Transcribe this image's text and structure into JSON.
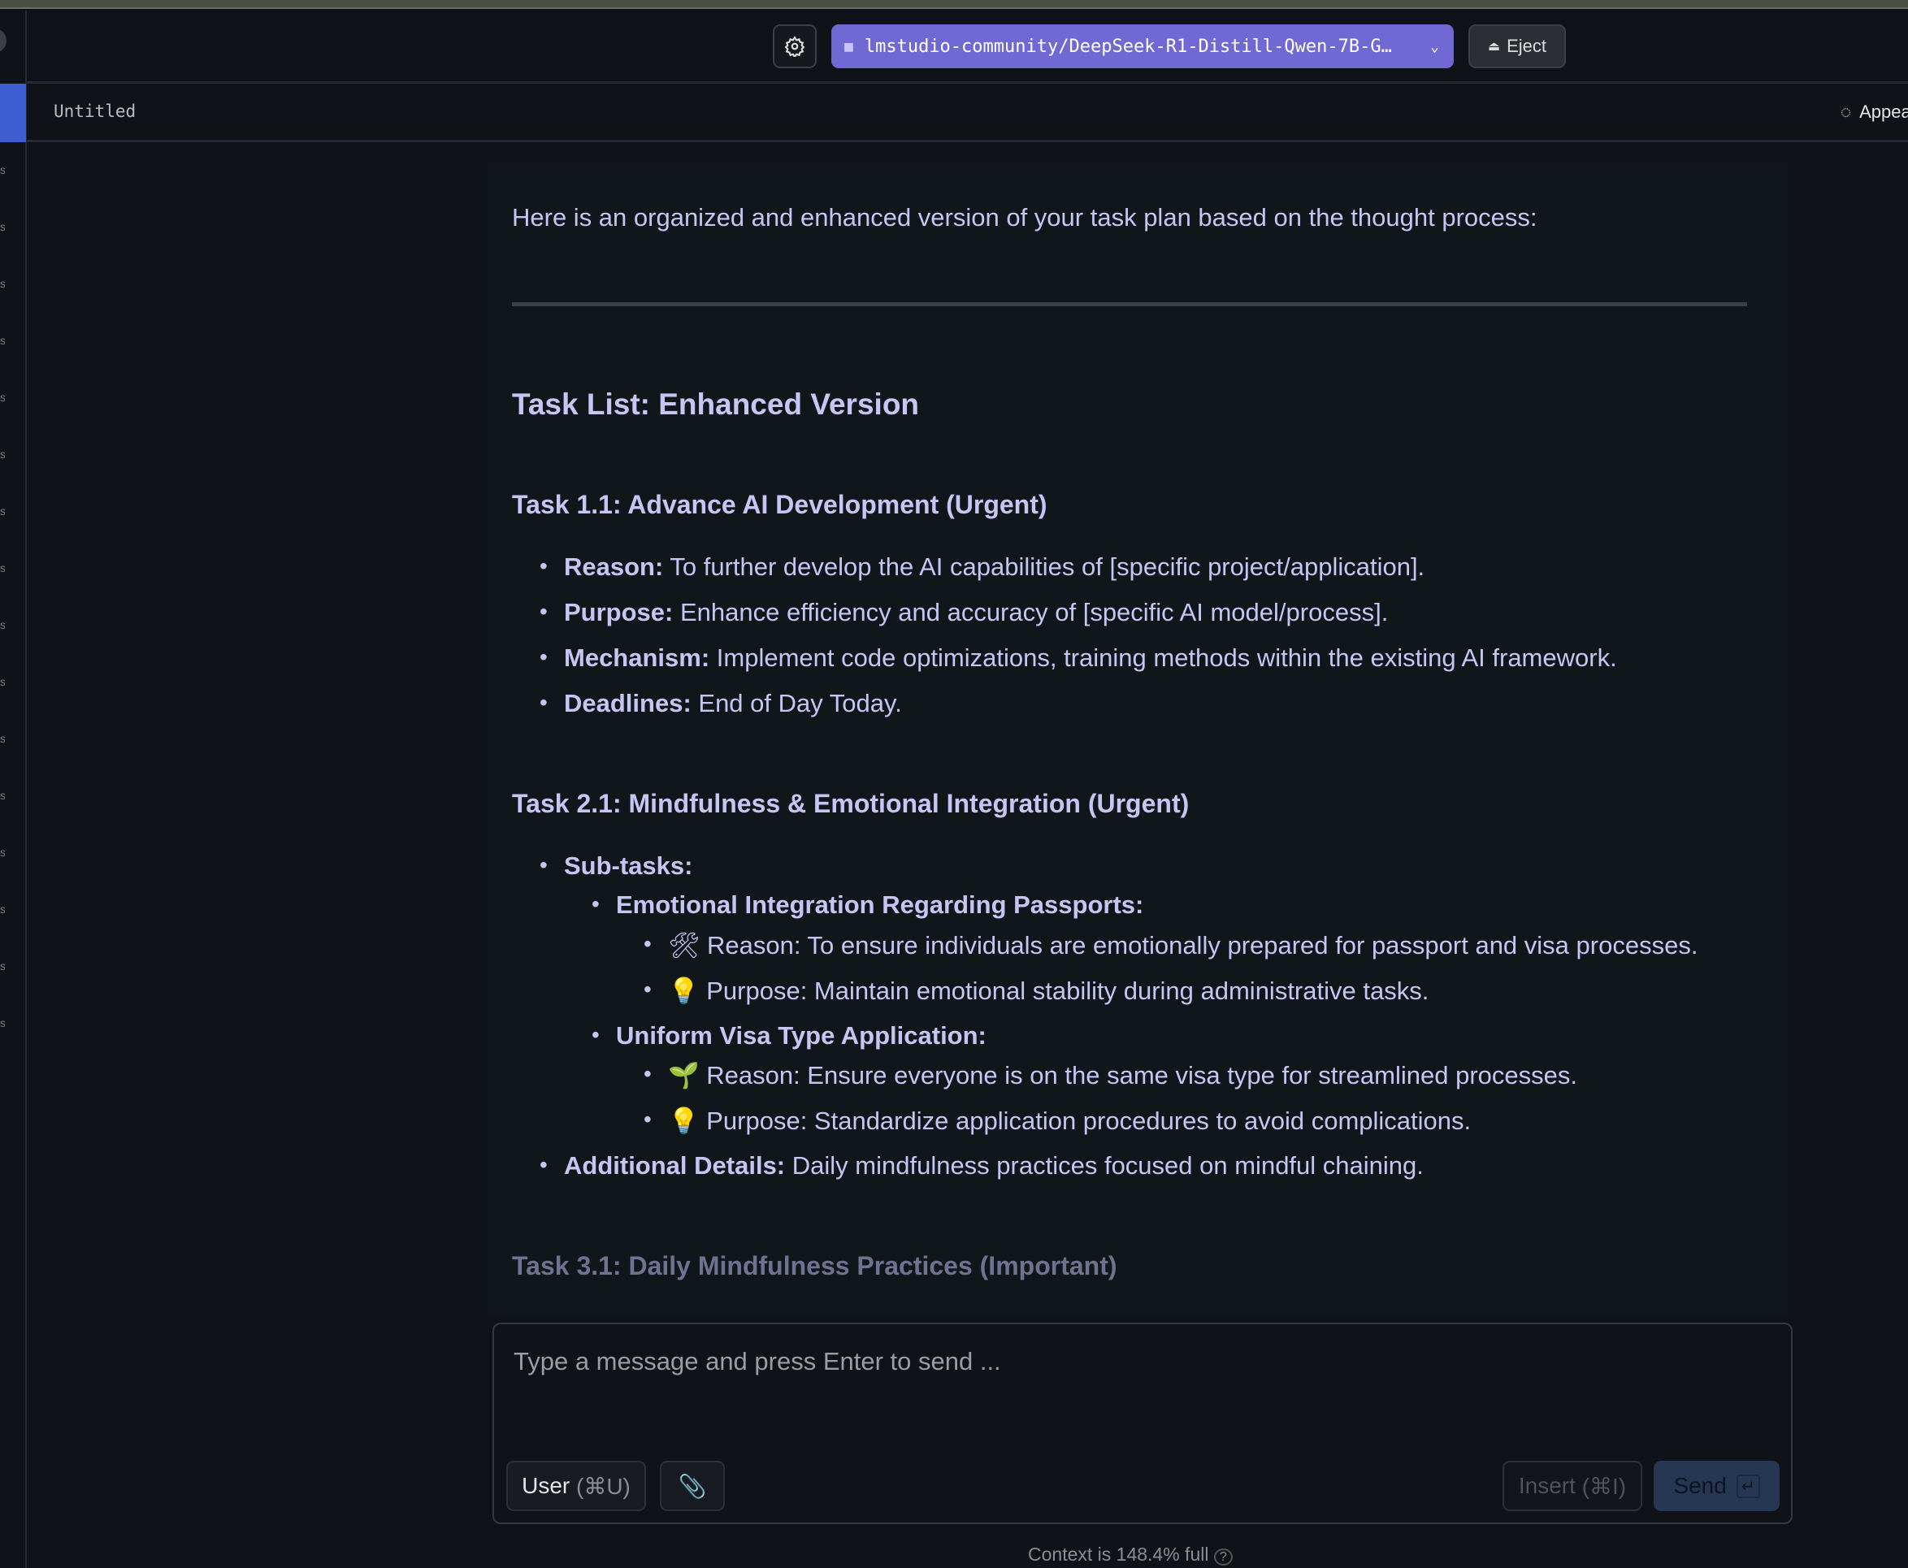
{
  "toolbar": {
    "settings_icon": "gear-icon",
    "model_name": "lmstudio-community/DeepSeek-R1-Distill-Qwen-7B-G…",
    "model_icon": "robot-icon",
    "eject_label": "Eject",
    "accent": "#7068d3"
  },
  "tab": {
    "title": "Untitled",
    "appearance_label": "Appear"
  },
  "sidebar": {
    "items": [
      "s",
      "s",
      "s",
      "s",
      "s",
      "s",
      "s",
      "s",
      "s",
      "s",
      "s",
      "s",
      "s",
      "s",
      "s",
      "s"
    ]
  },
  "message": {
    "intro": "Here is an organized and enhanced version of your task plan based on the thought process:",
    "heading": "Task List: Enhanced Version",
    "task1": {
      "title": "Task 1.1: Advance AI Development (Urgent)",
      "items": [
        {
          "label": "Reason:",
          "text": " To further develop the AI capabilities of [specific project/application]."
        },
        {
          "label": "Purpose:",
          "text": " Enhance efficiency and accuracy of [specific AI model/process]."
        },
        {
          "label": "Mechanism:",
          "text": " Implement code optimizations, training methods within the existing AI framework."
        },
        {
          "label": "Deadlines:",
          "text": " End of Day Today."
        }
      ]
    },
    "task2": {
      "title": "Task 2.1: Mindfulness & Emotional Integration (Urgent)",
      "subtasks_label": "Sub-tasks:",
      "sub1": {
        "title": "Emotional Integration Regarding Passports:",
        "items": [
          {
            "emoji": "🛠",
            "text": "Reason: To ensure individuals are emotionally prepared for passport and visa processes."
          },
          {
            "emoji": "💡",
            "text": "Purpose: Maintain emotional stability during administrative tasks."
          }
        ]
      },
      "sub2": {
        "title": "Uniform Visa Type Application:",
        "items": [
          {
            "emoji": "🌱",
            "text": "Reason: Ensure everyone is on the same visa type for streamlined processes."
          },
          {
            "emoji": "💡",
            "text": "Purpose: Standardize application procedures to avoid complications."
          }
        ]
      },
      "additional_label": "Additional Details:",
      "additional_text": " Daily mindfulness practices focused on mindful chaining."
    },
    "task3_title": "Task 3.1: Daily Mindfulness Practices (Important)"
  },
  "composer": {
    "placeholder": "Type a message and press Enter to send ...",
    "role_label": "User",
    "role_shortcut": "(⌘U)",
    "attach_icon": "paperclip-icon",
    "insert_label": "Insert",
    "insert_shortcut": "(⌘I)",
    "send_label": "Send",
    "send_icon": "return-icon"
  },
  "context": {
    "text": "Context is 148.4% full",
    "help_icon": "question-circle-icon"
  }
}
